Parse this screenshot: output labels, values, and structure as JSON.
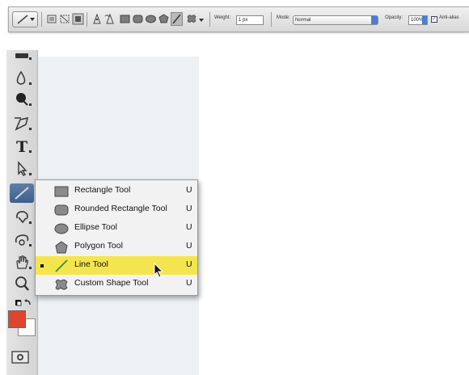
{
  "options_bar": {
    "weight_label": "Weight:",
    "weight_value": "1 px",
    "mode_label": "Mode:",
    "mode_value": "Normal",
    "opacity_label": "Opacity:",
    "opacity_value": "100%",
    "antialias_label": "Anti-alias",
    "antialias_checked": true,
    "shape_modes": [
      "shape-layers-icon",
      "paths-icon",
      "fill-pixels-icon"
    ],
    "shape_tools": [
      "pen-icon",
      "freeform-pen-icon",
      "rectangle-icon",
      "rounded-rectangle-icon",
      "ellipse-icon",
      "polygon-icon",
      "line-icon",
      "custom-shape-icon"
    ]
  },
  "tools_panel": {
    "items": [
      "brush-icon",
      "blur-icon",
      "dodge-icon",
      "pen-icon",
      "type-icon",
      "path-selection-icon",
      "line-icon",
      "3d-rotate-icon",
      "3d-orbit-icon",
      "hand-icon",
      "zoom-icon",
      "default-colors-icon"
    ],
    "foreground_color": "#e0452c",
    "background_color": "#ffffff"
  },
  "flyout": {
    "items": [
      {
        "label": "Rectangle Tool",
        "shortcut": "U",
        "icon": "rectangle-icon",
        "selected": false
      },
      {
        "label": "Rounded Rectangle Tool",
        "shortcut": "U",
        "icon": "rounded-rectangle-icon",
        "selected": false
      },
      {
        "label": "Ellipse Tool",
        "shortcut": "U",
        "icon": "ellipse-icon",
        "selected": false
      },
      {
        "label": "Polygon Tool",
        "shortcut": "U",
        "icon": "polygon-icon",
        "selected": false
      },
      {
        "label": "Line Tool",
        "shortcut": "U",
        "icon": "line-icon",
        "selected": true
      },
      {
        "label": "Custom Shape Tool",
        "shortcut": "U",
        "icon": "custom-shape-icon",
        "selected": false
      }
    ],
    "highlight_color": "#f4e54e"
  }
}
